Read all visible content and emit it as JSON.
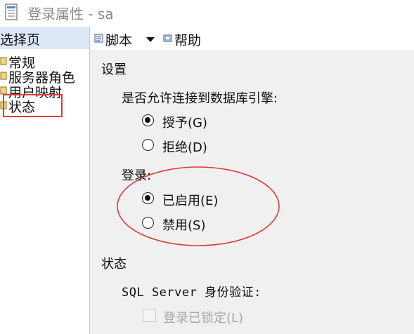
{
  "window": {
    "title": "登录属性 - sa",
    "icon": "document-icon"
  },
  "sidebar": {
    "header": "选择页",
    "items": [
      {
        "label": "常规",
        "icon": "page-icon"
      },
      {
        "label": "服务器角色",
        "icon": "page-icon"
      },
      {
        "label": "用户映射",
        "icon": "page-icon"
      },
      {
        "label": "状态",
        "icon": "page-icon",
        "selected": true
      }
    ]
  },
  "toolbar": {
    "script_label": "脚本",
    "help_label": "帮助"
  },
  "settings": {
    "section_title": "设置",
    "db_engine_label": "是否允许连接到数据库引擎:",
    "grant_label": "授予(G)",
    "deny_label": "拒绝(D)",
    "db_engine_value": "授予(G)",
    "login_label": "登录:",
    "enabled_label": "已启用(E)",
    "disabled_label": "禁用(S)",
    "login_value": "已启用(E)"
  },
  "status": {
    "section_title": "状态",
    "auth_label": "SQL Server 身份验证:",
    "locked_label": "登录已锁定(L)",
    "locked_checked": false
  },
  "colors": {
    "annotation_red": "#e03a3a",
    "sidebar_header_bg": "#dde8f6",
    "content_bg": "#f0f0f0",
    "title_gray": "#8a8a8a"
  }
}
